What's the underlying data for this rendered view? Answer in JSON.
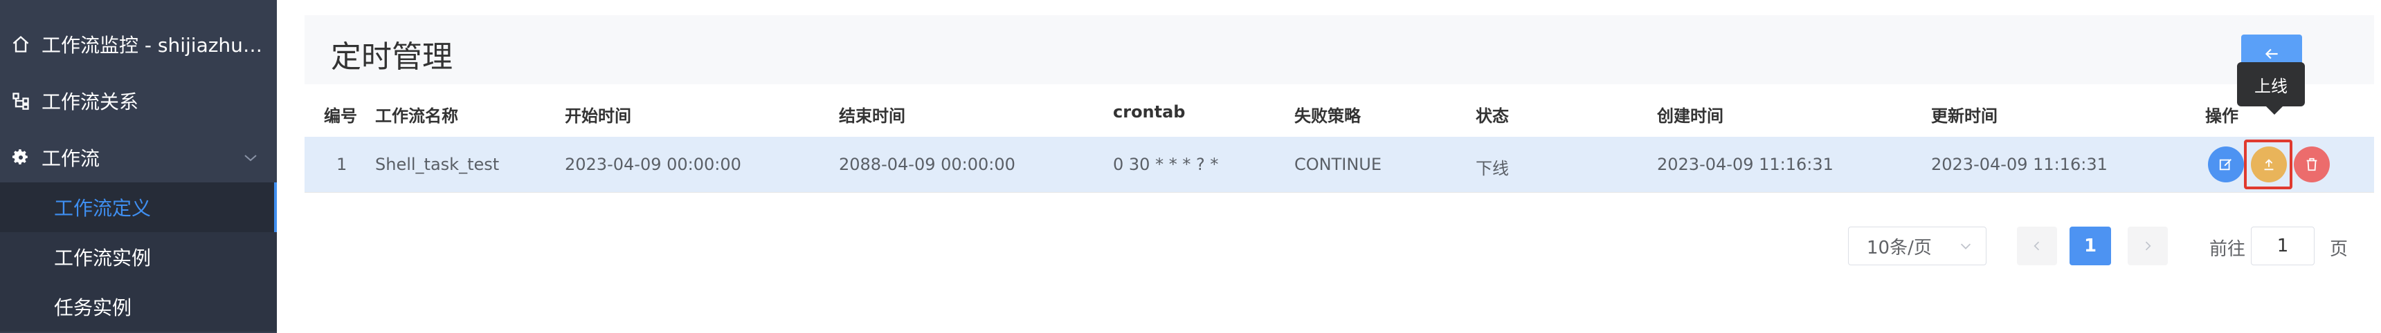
{
  "sidebar": {
    "items": [
      {
        "label": "工作流监控 - shijiazhuan…",
        "icon": "home-icon"
      },
      {
        "label": "工作流关系",
        "icon": "relation-icon"
      },
      {
        "label": "工作流",
        "icon": "gear-icon"
      }
    ],
    "subitems": [
      {
        "label": "工作流定义",
        "active": true
      },
      {
        "label": "工作流实例",
        "active": false
      },
      {
        "label": "任务实例",
        "active": false
      }
    ]
  },
  "page": {
    "title": "定时管理",
    "back_icon": "arrow-left-icon"
  },
  "table": {
    "headers": [
      "编号",
      "工作流名称",
      "开始时间",
      "结束时间",
      "crontab",
      "失败策略",
      "状态",
      "创建时间",
      "更新时间",
      "操作"
    ],
    "rows": [
      {
        "id": "1",
        "name": "Shell_task_test",
        "start": "2023-04-09 00:00:00",
        "end": "2088-04-09 00:00:00",
        "crontab": "0 30 * * * ? *",
        "failure_strategy": "CONTINUE",
        "status": "下线",
        "created": "2023-04-09 11:16:31",
        "updated": "2023-04-09 11:16:31"
      }
    ],
    "actions": {
      "edit_icon": "edit-icon",
      "online_icon": "upload-icon",
      "delete_icon": "trash-icon",
      "tooltip": "上线"
    }
  },
  "pagination": {
    "page_size": "10条/页",
    "current_page": "1",
    "goto_label": "前往",
    "goto_value": "1",
    "goto_suffix": "页"
  },
  "colors": {
    "sidebar_bg": "#363e4f",
    "active_text": "#3f8ff1",
    "primary": "#4d93f2",
    "warning": "#e9b45a",
    "danger": "#ec6c6c",
    "row_highlight": "#e1ecfa",
    "annotation_box": "#e03a2f"
  }
}
